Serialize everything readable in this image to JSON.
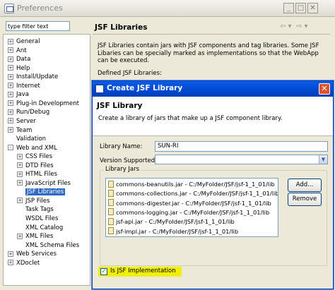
{
  "window": {
    "title": "Preferences",
    "controls": [
      "_",
      "□",
      "✕"
    ]
  },
  "filter": {
    "placeholder": "type filter text"
  },
  "tree": [
    {
      "label": "General",
      "level": 0,
      "expander": "+"
    },
    {
      "label": "Ant",
      "level": 0,
      "expander": "+"
    },
    {
      "label": "Data",
      "level": 0,
      "expander": "+"
    },
    {
      "label": "Help",
      "level": 0,
      "expander": "+"
    },
    {
      "label": "Install/Update",
      "level": 0,
      "expander": "+"
    },
    {
      "label": "Internet",
      "level": 0,
      "expander": "+"
    },
    {
      "label": "Java",
      "level": 0,
      "expander": "+"
    },
    {
      "label": "Plug-in Development",
      "level": 0,
      "expander": "+"
    },
    {
      "label": "Run/Debug",
      "level": 0,
      "expander": "+"
    },
    {
      "label": "Server",
      "level": 0,
      "expander": "+"
    },
    {
      "label": "Team",
      "level": 0,
      "expander": "+"
    },
    {
      "label": "Validation",
      "level": 0,
      "expander": ""
    },
    {
      "label": "Web and XML",
      "level": 0,
      "expander": "-"
    },
    {
      "label": "CSS Files",
      "level": 1,
      "expander": "+"
    },
    {
      "label": "DTD Files",
      "level": 1,
      "expander": "+"
    },
    {
      "label": "HTML Files",
      "level": 1,
      "expander": "+"
    },
    {
      "label": "JavaScript Files",
      "level": 1,
      "expander": "+"
    },
    {
      "label": "JSF Libraries",
      "level": 1,
      "expander": "",
      "selected": true
    },
    {
      "label": "JSP Files",
      "level": 1,
      "expander": "+"
    },
    {
      "label": "Task Tags",
      "level": 1,
      "expander": ""
    },
    {
      "label": "WSDL Files",
      "level": 1,
      "expander": ""
    },
    {
      "label": "XML Catalog",
      "level": 1,
      "expander": ""
    },
    {
      "label": "XML Files",
      "level": 1,
      "expander": "+"
    },
    {
      "label": "XML Schema Files",
      "level": 1,
      "expander": ""
    },
    {
      "label": "Web Services",
      "level": 0,
      "expander": "+"
    },
    {
      "label": "XDoclet",
      "level": 0,
      "expander": "+"
    }
  ],
  "page": {
    "title": "JSF Libraries",
    "nav_back": "⇦ ▾",
    "nav_fwd": "⇨ ▾",
    "description": "JSF Libraries contain jars with JSF components and tag libraries.  Some JSF Libaries can be specially marked as implementations so that the WebApp can be executed.",
    "defined_label": "Defined JSF Libraries:"
  },
  "dialog": {
    "title": "Create JSF Library",
    "close": "✕",
    "heading": "JSF Library",
    "subtitle": "Create a library of jars that make up a JSF component library.",
    "library_name_label": "Library Name:",
    "library_name_value": "SUN-RI",
    "version_label": "Version Supported:",
    "version_value": "",
    "jars_group_label": "Library Jars",
    "jars": [
      "commons-beanutils.jar - C:/MyFolder/JSF/jsf-1_1_01/lib",
      "commons-collections.jar - C:/MyFolder/JSF/jsf-1_1_01/lib",
      "commons-digester.jar - C:/MyFolder/JSF/jsf-1_1_01/lib",
      "commons-logging.jar - C:/MyFolder/JSF/jsf-1_1_01/lib",
      "jsf-api.jar - C:/MyFolder/JSF/jsf-1_1_01/lib",
      "jsf-impl.jar - C:/MyFolder/JSF/jsf-1_1_01/lib"
    ],
    "add_button": "Add...",
    "remove_button": "Remove",
    "implementation_checkbox": "Is JSF Implementation",
    "implementation_checked": true,
    "check_glyph": "✓"
  },
  "colors": {
    "dialog_title": "#0048d0",
    "highlight": "#f0f000",
    "selection": "#316ac5"
  }
}
